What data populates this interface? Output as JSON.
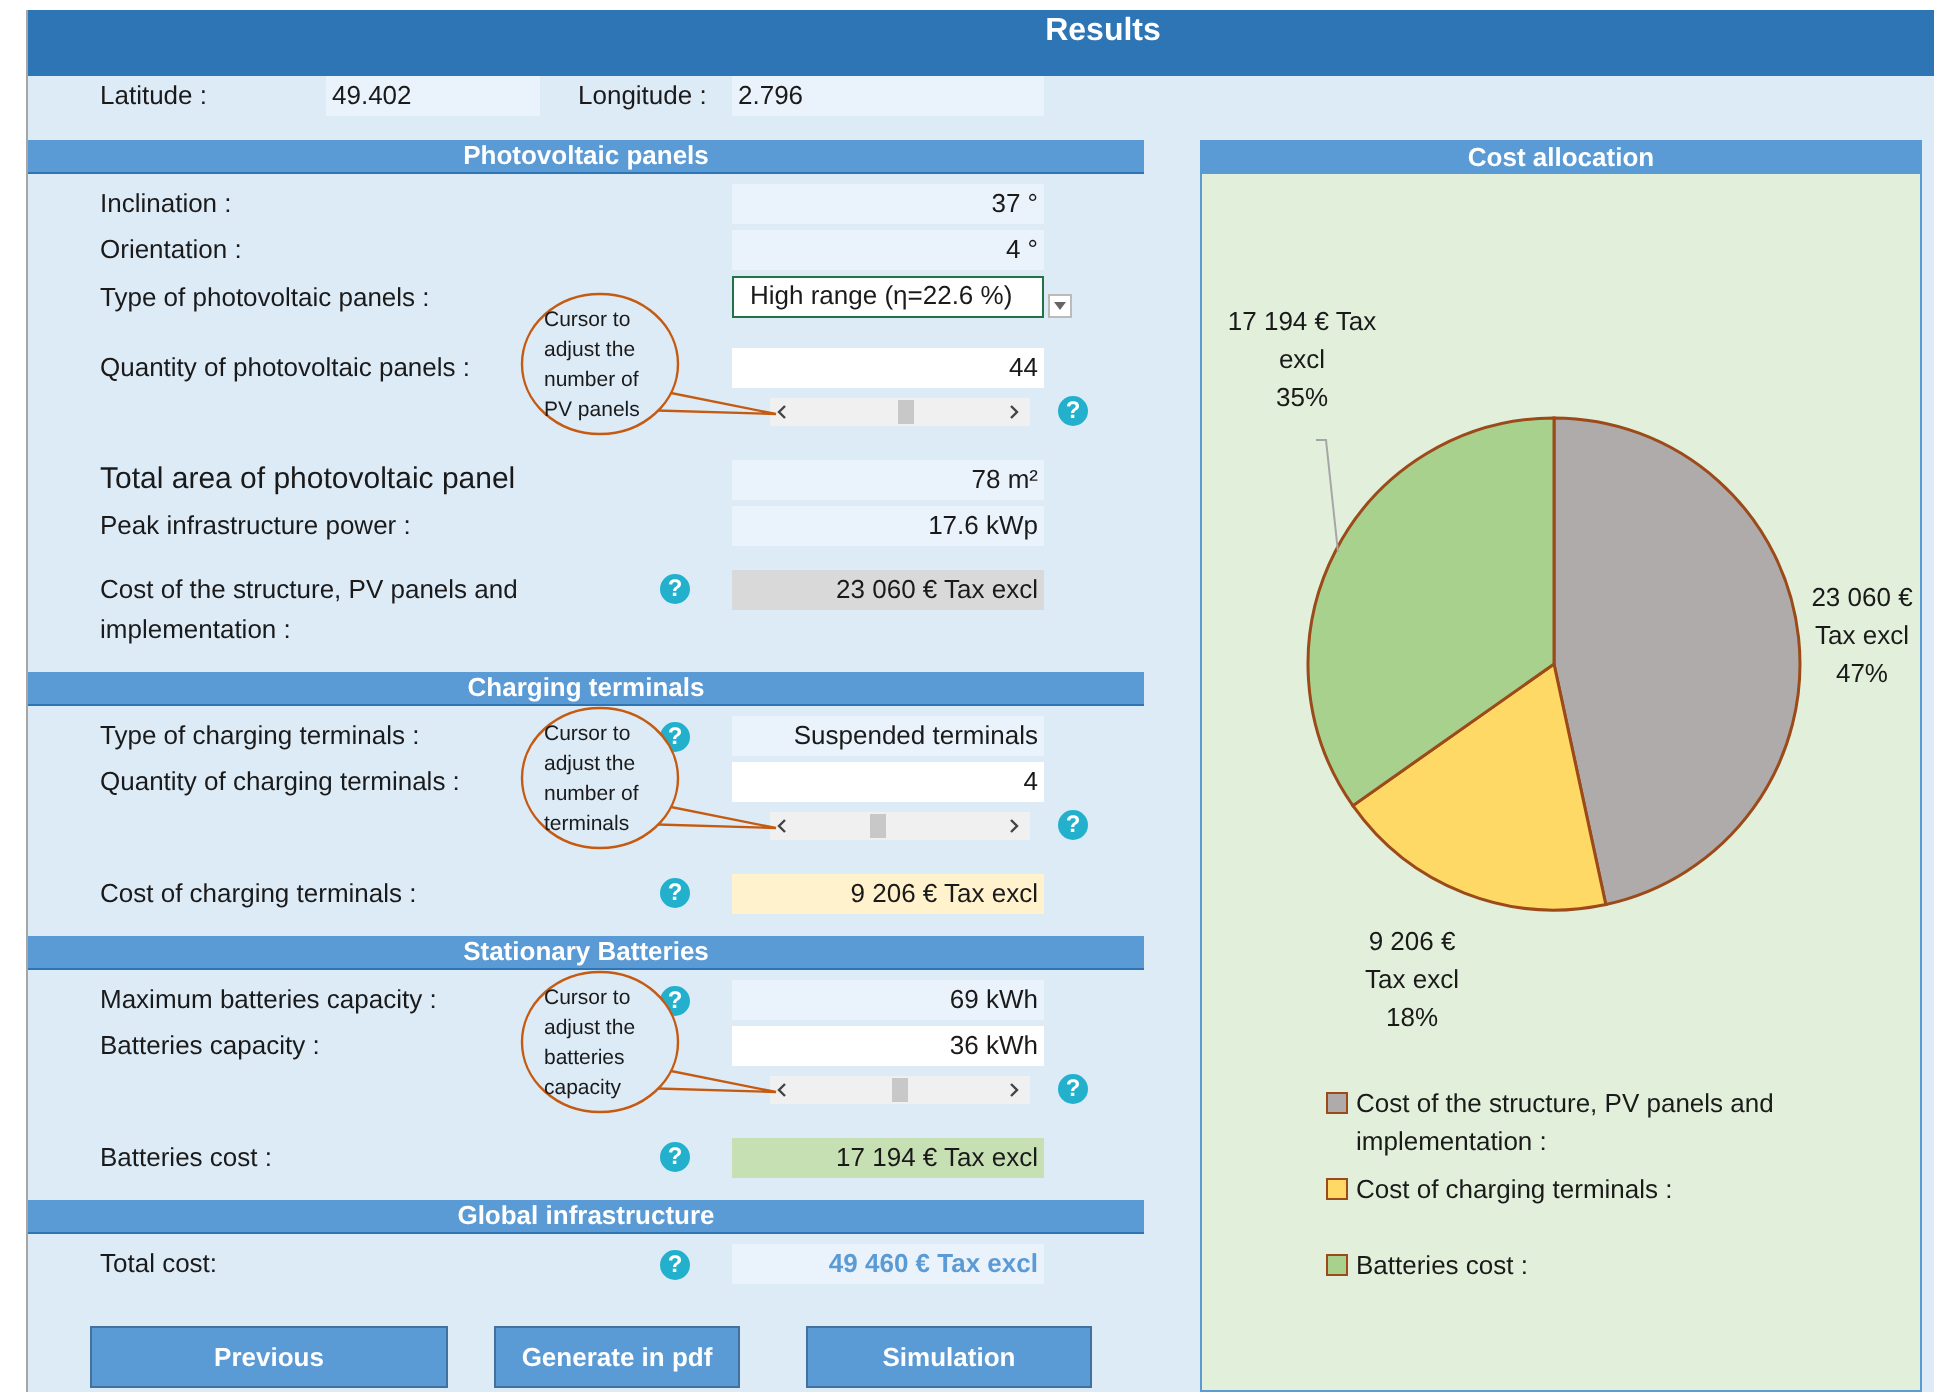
{
  "title": "Results",
  "help_symbol": "?",
  "location": [
    {
      "label": "Latitude :",
      "value": "49.402"
    },
    {
      "label": "Longitude :",
      "value": "2.796"
    }
  ],
  "sections": [
    {
      "title": "Photovoltaic panels",
      "rows": [
        {
          "kind": "readout",
          "label": "Inclination :",
          "value": "37 °",
          "help": false,
          "large": false
        },
        {
          "kind": "readout",
          "label": "Orientation :",
          "value": "4 °",
          "help": false,
          "large": false
        },
        {
          "kind": "dropdown",
          "label": "Type of photovoltaic panels :",
          "value": "High range (η=22.6 %)",
          "help": false,
          "large": false
        },
        {
          "kind": "input",
          "label": "Quantity of photovoltaic panels :",
          "value": "44",
          "help": false,
          "large": false
        },
        {
          "kind": "slider",
          "level": 0.53,
          "help": true,
          "callout": "Cursor to adjust the number of PV panels"
        },
        {
          "kind": "readout",
          "label": "Total area of photovoltaic panel",
          "value": "78 m²",
          "help": false,
          "large": true
        },
        {
          "kind": "readout",
          "label": "Peak infrastructure power :",
          "value": "17.6 kWp",
          "help": false,
          "large": false
        },
        {
          "kind": "total",
          "label": "Cost of the structure, PV panels and implementation :",
          "value": "23 060 €  Tax excl",
          "help": true,
          "large": false,
          "color": "#d9d9d9"
        }
      ]
    },
    {
      "title": "Charging terminals",
      "rows": [
        {
          "kind": "readout",
          "label": "Type of charging terminals :",
          "value": "Suspended terminals",
          "help": true,
          "large": false
        },
        {
          "kind": "input",
          "label": "Quantity of charging terminals :",
          "value": "4",
          "help": false,
          "large": false
        },
        {
          "kind": "slider",
          "level": 0.39,
          "help": true,
          "callout": "Cursor to adjust the number of terminals"
        },
        {
          "kind": "total",
          "label": "Cost of charging terminals  :",
          "value": "9 206 € Tax excl",
          "help": true,
          "large": false,
          "color": "#fff2cc"
        }
      ]
    },
    {
      "title": "Stationary Batteries",
      "rows": [
        {
          "kind": "readout",
          "label": "Maximum batteries capacity :",
          "value": "69 kWh",
          "help": true,
          "large": false
        },
        {
          "kind": "input",
          "label": "Batteries capacity :",
          "value": "36 kWh",
          "help": false,
          "large": false
        },
        {
          "kind": "slider",
          "level": 0.5,
          "help": true,
          "callout": "Cursor to adjust the batteries capacity"
        },
        {
          "kind": "total",
          "label": "Batteries cost :",
          "value": "17 194 € Tax excl",
          "help": true,
          "large": false,
          "color": "#c6e0b4"
        }
      ]
    },
    {
      "title": "Global infrastructure",
      "rows": [
        {
          "kind": "grand_total",
          "label": "Total cost:",
          "value": "49 460 € Tax excl",
          "help": true,
          "large": false
        }
      ]
    }
  ],
  "buttons": [
    {
      "label": "Previous"
    },
    {
      "label": "Generate in pdf"
    },
    {
      "label": "Simulation"
    }
  ],
  "cost_panel": {
    "title": "Cost allocation",
    "legend_separator": ":",
    "chart_data": {
      "type": "pie",
      "categories": [
        "Cost of the structure, PV panels and implementation",
        "Cost of charging terminals",
        "Batteries cost"
      ],
      "values": [
        23060,
        9206,
        17194
      ],
      "colors": [
        "#afabab",
        "#ffd966",
        "#a9d18e"
      ],
      "value_labels": [
        "23 060 €\nTax excl\n47%",
        "9 206 €\nTax excl\n18%",
        "17 194 € Tax\nexcl\n35%"
      ]
    }
  }
}
